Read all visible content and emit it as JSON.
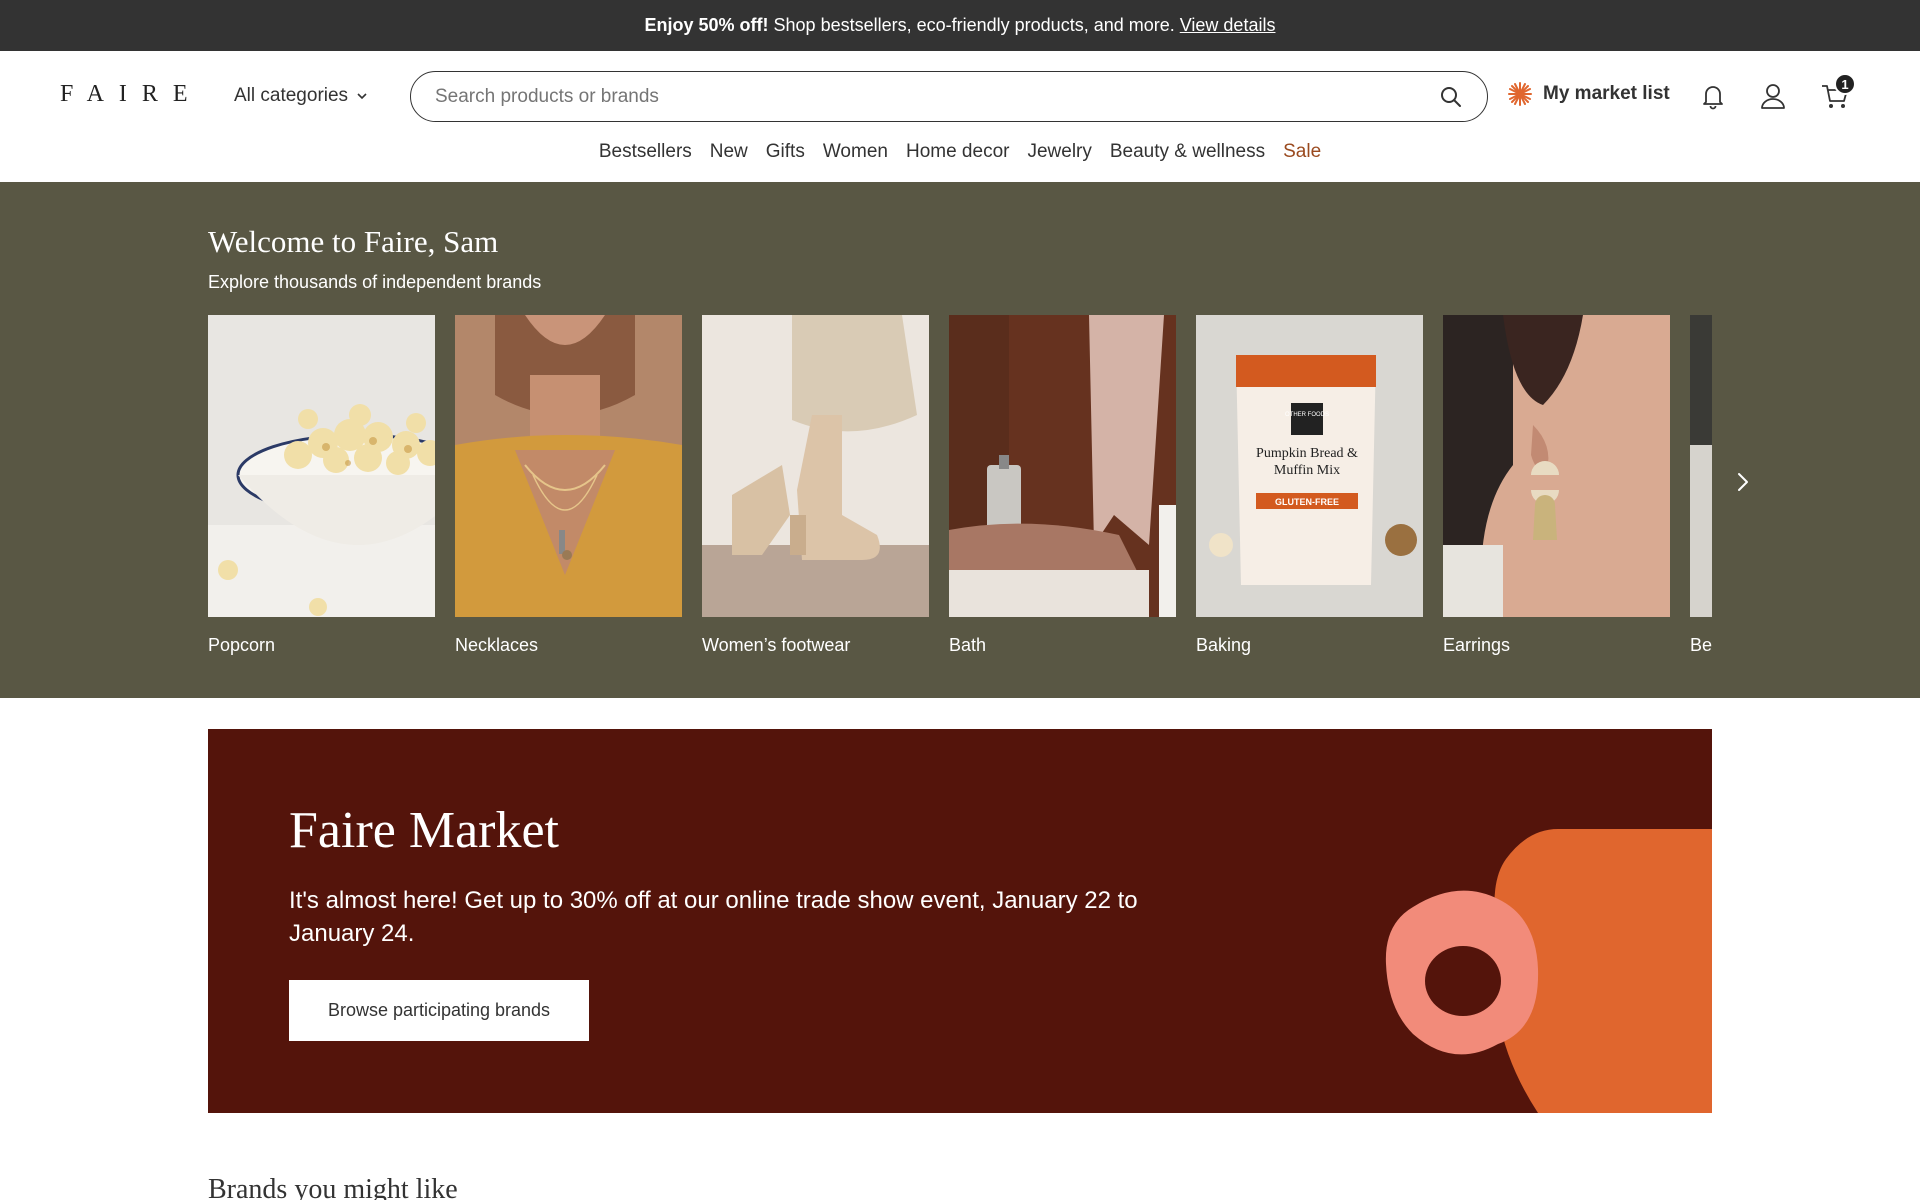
{
  "promo": {
    "bold": "Enjoy 50% off!",
    "text": "Shop bestsellers, eco-friendly products, and more.",
    "link": "View details"
  },
  "header": {
    "logo": "FAIRE",
    "categories": "All categories",
    "search_placeholder": "Search products or brands",
    "market_list": "My market list",
    "cart_count": "1",
    "icons": [
      "search-icon",
      "sunburst-icon",
      "bell-icon",
      "user-icon",
      "cart-icon"
    ]
  },
  "nav": {
    "items": [
      "Bestsellers",
      "New",
      "Gifts",
      "Women",
      "Home decor",
      "Jewelry",
      "Beauty & wellness",
      "Sale"
    ]
  },
  "welcome": {
    "title": "Welcome to Faire, Sam",
    "subtitle": "Explore thousands of independent brands",
    "categories": [
      "Popcorn",
      "Necklaces",
      "Women’s footwear",
      "Bath",
      "Baking",
      "Earrings",
      "Be"
    ],
    "baking_pack": {
      "brand": "OTHER FOODS",
      "product": "Pumpkin Bread & Muffin Mix",
      "claim": "GLUTEN-FREE"
    }
  },
  "market": {
    "title": "Faire Market",
    "text": "It's almost here! Get up to 30% off at our online trade show event, January 22 to January 24.",
    "button": "Browse participating brands"
  },
  "brands": {
    "title": "Brands you might like"
  },
  "colors": {
    "promo_bg": "#333333",
    "welcome_bg": "#595744",
    "banner_bg": "#54140b",
    "sale": "#9a4a1f",
    "orange": "#e0662e",
    "pink": "#f28b7a"
  }
}
